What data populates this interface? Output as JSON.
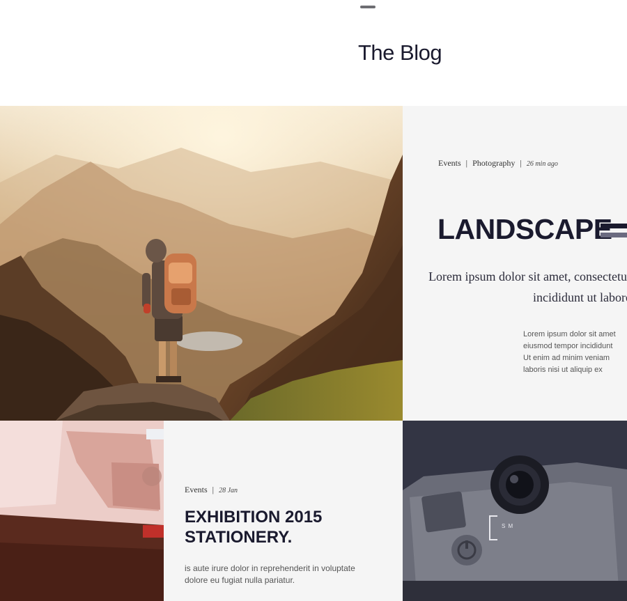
{
  "header": {
    "title": "The Blog"
  },
  "hero_image": {
    "description_icon": "mountain-hiker-photo"
  },
  "landscape_post": {
    "categories": [
      "Events",
      "Photography"
    ],
    "separator": "|",
    "time": "26 min ago",
    "title": "LANDSCAPE",
    "lead": "Lorem ipsum dolor sit amet, consectetur incididunt ut labore",
    "body": "Lorem ipsum dolor sit amet\neiusmod tempor incididunt\nUt enim ad minim veniam\nlaboris nisi ut aliquip ex"
  },
  "exhibition_post": {
    "category": "Events",
    "separator": "|",
    "date": "28 Jan",
    "title_line1": "EXHIBITION 2015",
    "title_line2": "STATIONERY.",
    "body": "is aute irure dolor in reprehenderit in voluptate\ndolore eu fugiat nulla pariatur."
  },
  "camera_image": {
    "label": "S M"
  },
  "colors": {
    "heading": "#1a1a2e",
    "card_bg": "#f5f5f5",
    "text_muted": "#555555"
  }
}
